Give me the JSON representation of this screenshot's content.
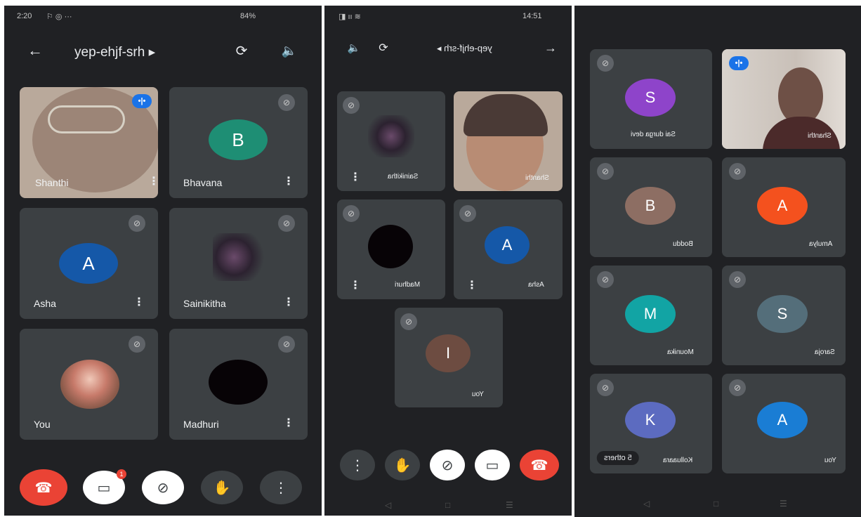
{
  "phone1": {
    "status": {
      "time": "2:20",
      "battery": "84%"
    },
    "title": "yep-ehjf-srh ▸",
    "tiles": [
      {
        "name": "Shanthi"
      },
      {
        "name": "Bhavana",
        "initial": "B",
        "color": "#1e8e74"
      },
      {
        "name": "Asha",
        "initial": "A",
        "color": "#1558a8"
      },
      {
        "name": "Sainikitha"
      },
      {
        "name": "You"
      },
      {
        "name": "Madhuri"
      }
    ],
    "notification_count": "1"
  },
  "phone2": {
    "status": {
      "time": "14:51"
    },
    "title": "yep-ehjf-srh ▸",
    "tiles": [
      {
        "name": "Sainikitha"
      },
      {
        "name": "Shanthi"
      },
      {
        "name": "Madhuri"
      },
      {
        "name": "Asha",
        "initial": "A",
        "color": "#1558a8"
      },
      {
        "name": "You",
        "initial": "I",
        "color": "#6d4c41"
      }
    ]
  },
  "phone3": {
    "tiles": [
      {
        "name": "Sai durga devi",
        "initial": "S",
        "color": "#8e44ca"
      },
      {
        "name": "Shanthi"
      },
      {
        "name": "Boddu",
        "initial": "B",
        "color": "#8d6e63"
      },
      {
        "name": "Amulya",
        "initial": "A",
        "color": "#f4511e"
      },
      {
        "name": "Mounika",
        "initial": "M",
        "color": "#12a4a4"
      },
      {
        "name": "Saroja",
        "initial": "S",
        "color": "#546e7a"
      },
      {
        "name": "Kolluaara",
        "initial": "K",
        "color": "#5c6bc0"
      },
      {
        "name": "You",
        "initial": "A",
        "color": "#1a7dd4"
      }
    ],
    "others_label": "5 others"
  }
}
